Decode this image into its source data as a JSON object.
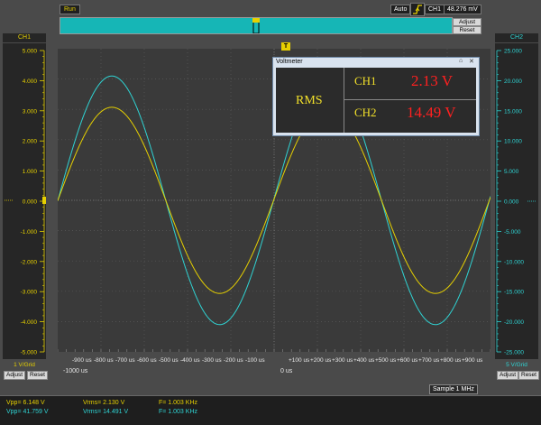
{
  "status": {
    "run": "Run",
    "mode": "Auto",
    "trigger_channel": "CH1",
    "trigger_level": "48.276 mV"
  },
  "top_buttons": {
    "adjust": "Adjust",
    "reset": "Reset"
  },
  "ch1": {
    "title": "CH1",
    "grid": "1 V/Grid",
    "adjust": "Adjust",
    "reset": "Reset",
    "scale": [
      "5.000",
      "4.000",
      "3.000",
      "2.000",
      "1.000",
      "0.000",
      "-1.000",
      "-2.000",
      "-3.000",
      "-4.000",
      "-5.000"
    ],
    "color": "#e6d000",
    "amplitude_v": 3.07
  },
  "ch2": {
    "title": "CH2",
    "grid": "5 V/Grid",
    "adjust": "Adjust",
    "reset": "Reset",
    "scale": [
      "25.000",
      "20.000",
      "15.000",
      "10.000",
      "5.000",
      "0.000",
      "-5.000",
      "-10.000",
      "-15.000",
      "-20.000",
      "-25.000"
    ],
    "color": "#2fd3d3",
    "amplitude_v": 20.5
  },
  "time_axis": {
    "start_label": "-1000 us",
    "zero_label": "0 us",
    "ticks": [
      "-900 us",
      "-800 us",
      "-700 us",
      "-600 us",
      "-500 us",
      "-400 us",
      "-300 us",
      "-200 us",
      "-100 us",
      "+100 us",
      "+200 us",
      "+300 us",
      "+400 us",
      "+500 us",
      "+600 us",
      "+700 us",
      "+800 us",
      "+900 us"
    ]
  },
  "sample": "Sample 1 MHz",
  "measurements": {
    "ch1": {
      "vpp": "Vpp= 6.148 V",
      "vrms": "Vrms= 2.130 V",
      "freq": "F= 1.003 KHz"
    },
    "ch2": {
      "vpp": "Vpp= 41.759 V",
      "vrms": "Vrms= 14.491 V",
      "freq": "F= 1.003 KHz"
    }
  },
  "voltmeter": {
    "title": "Voltmeter",
    "pin": "⌂",
    "close": "✕",
    "rms": "RMS",
    "ch1_label": "CH1",
    "ch1_value": "2.13 V",
    "ch2_label": "CH2",
    "ch2_value": "14.49 V"
  },
  "trigger_marker": "T",
  "waveform": {
    "frequency_hz": 1003,
    "time_start_us": -1000,
    "time_end_us": 1000,
    "peak_time_us": -750
  }
}
